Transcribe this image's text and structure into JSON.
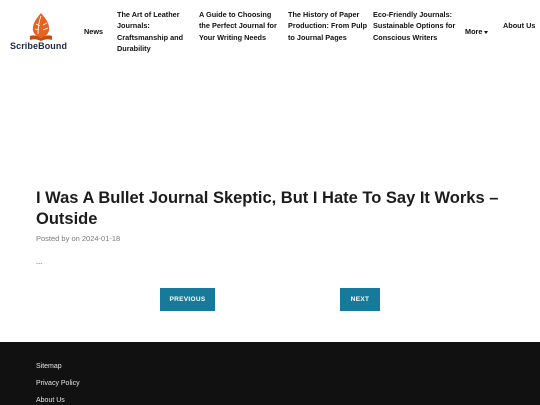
{
  "brand": {
    "name": "ScribeBound",
    "logo_icon": "quill-book-icon",
    "accent": "#e8621f"
  },
  "nav": {
    "news": "News",
    "articles": [
      "The Art of Leather Journals: Craftsmanship and Durability",
      "A Guide to Choosing the Perfect Journal for Your Writing Needs",
      "The History of Paper Production: From Pulp to Journal Pages",
      "Eco-Friendly Journals: Sustainable Options for Conscious Writers"
    ],
    "more": "More",
    "about": "About Us"
  },
  "post": {
    "title": "I Was A Bullet Journal Skeptic, But I Hate To Say It Works – Outside",
    "meta": "Posted by on 2024-01-18",
    "excerpt": "..."
  },
  "pagination": {
    "previous": "PREVIOUS",
    "next": "NEXT",
    "color": "#167a9a"
  },
  "footer": {
    "links": [
      "Sitemap",
      "Privacy Policy",
      "About Us"
    ],
    "background": "#111111"
  }
}
